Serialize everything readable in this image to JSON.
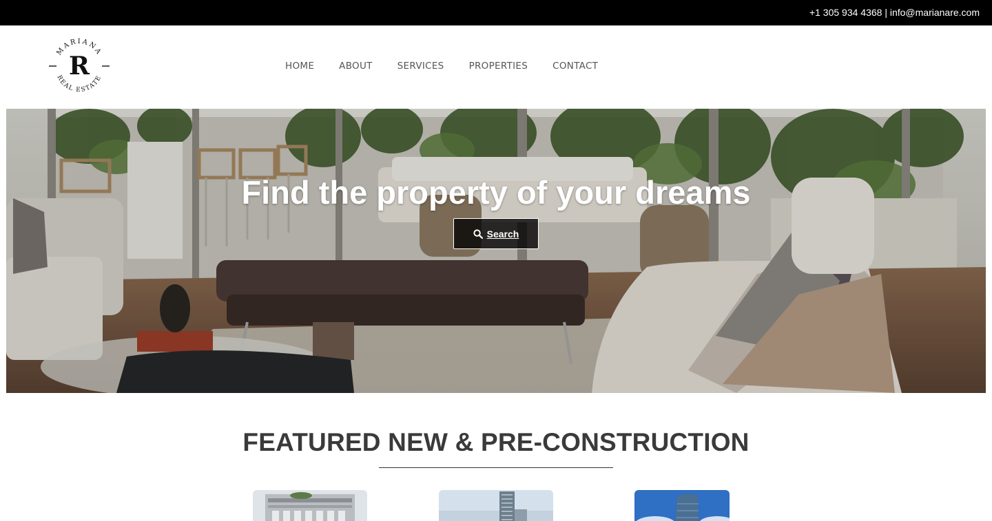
{
  "topbar": {
    "contact": "+1 305 934 4368 | info@marianare.com"
  },
  "logo": {
    "top_text": "MARIANA",
    "letter": "R",
    "bottom_text": "REAL ESTATE"
  },
  "nav": {
    "items": [
      "HOME",
      "ABOUT",
      "SERVICES",
      "PROPERTIES",
      "CONTACT"
    ]
  },
  "hero": {
    "title": "Find the property of your dreams",
    "search_label": "Search"
  },
  "featured": {
    "title": "FEATURED NEW & PRE-CONSTRUCTION"
  },
  "colors": {
    "topbar_bg": "#000000",
    "heading": "#3a3a3a",
    "nav_text": "#555555"
  }
}
